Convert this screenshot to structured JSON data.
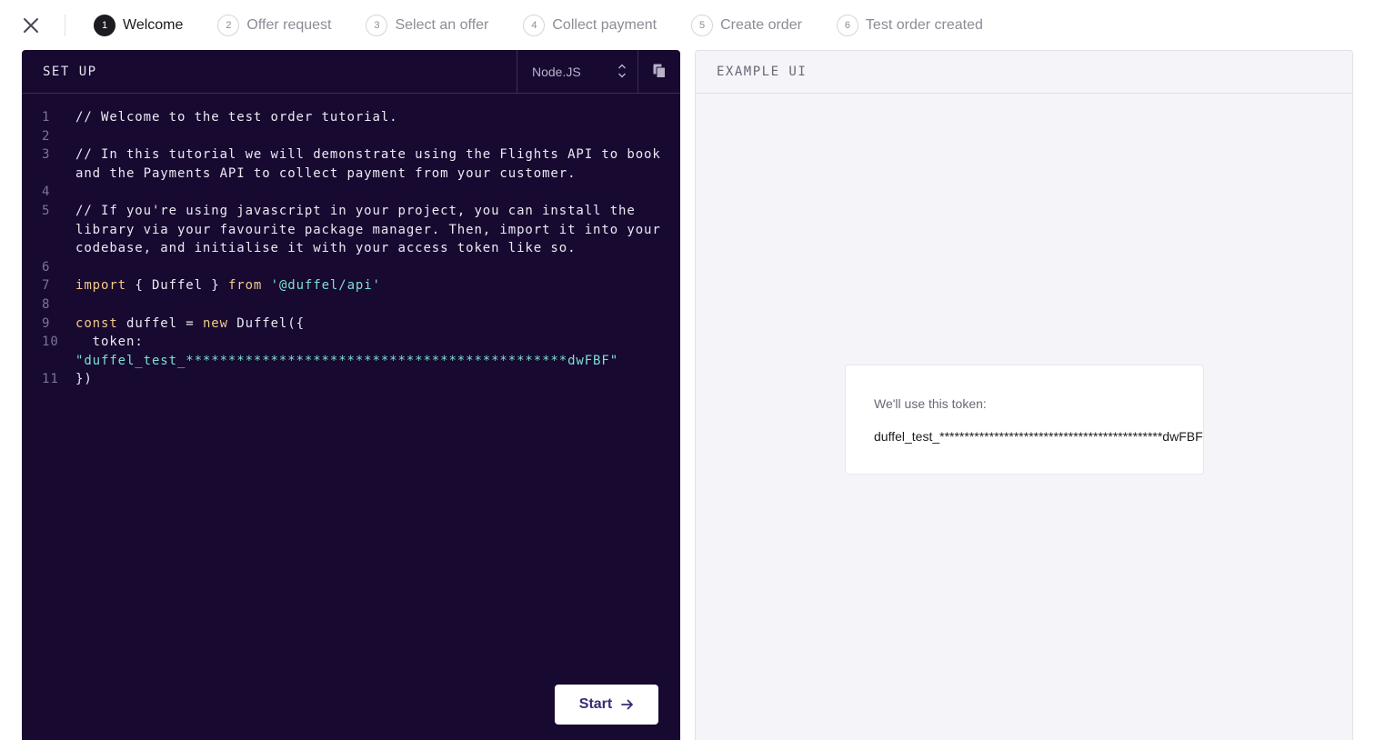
{
  "steps": [
    {
      "num": "1",
      "label": "Welcome"
    },
    {
      "num": "2",
      "label": "Offer request"
    },
    {
      "num": "3",
      "label": "Select an offer"
    },
    {
      "num": "4",
      "label": "Collect payment"
    },
    {
      "num": "5",
      "label": "Create order"
    },
    {
      "num": "6",
      "label": "Test order created"
    }
  ],
  "active_step": 1,
  "code_panel": {
    "title": "SET UP",
    "language": "Node.JS",
    "lines": [
      {
        "n": "1",
        "tokens": [
          {
            "t": "// Welcome to the test order tutorial.",
            "c": "plain"
          }
        ]
      },
      {
        "n": "2",
        "tokens": []
      },
      {
        "n": "3",
        "tokens": [
          {
            "t": "// In this tutorial we will demonstrate using the Flights API to book and the Payments API to collect payment from your customer.",
            "c": "plain"
          }
        ]
      },
      {
        "n": "4",
        "tokens": []
      },
      {
        "n": "5",
        "tokens": [
          {
            "t": "// If you're using javascript in your project, you can install the library via your favourite package manager. Then, import it into your codebase, and initialise it with your access token like so.",
            "c": "plain"
          }
        ]
      },
      {
        "n": "6",
        "tokens": []
      },
      {
        "n": "7",
        "tokens": [
          {
            "t": "import",
            "c": "kw"
          },
          {
            "t": " { Duffel } ",
            "c": "plain"
          },
          {
            "t": "from",
            "c": "kw"
          },
          {
            "t": " ",
            "c": "plain"
          },
          {
            "t": "'@duffel/api'",
            "c": "str"
          }
        ]
      },
      {
        "n": "8",
        "tokens": []
      },
      {
        "n": "9",
        "tokens": [
          {
            "t": "const",
            "c": "kw"
          },
          {
            "t": " duffel = ",
            "c": "plain"
          },
          {
            "t": "new",
            "c": "kw"
          },
          {
            "t": " Duffel({",
            "c": "plain"
          }
        ]
      },
      {
        "n": "10",
        "tokens": [
          {
            "t": "  token: ",
            "c": "plain"
          },
          {
            "t": "\"duffel_test_*********************************************dwFBF\"",
            "c": "str"
          }
        ]
      },
      {
        "n": "11",
        "tokens": [
          {
            "t": "})",
            "c": "plain"
          }
        ]
      }
    ],
    "start_label": "Start"
  },
  "example_panel": {
    "title": "EXAMPLE UI",
    "token_caption": "We'll use this token:",
    "token_value": "duffel_test_*********************************************dwFBF"
  },
  "colors": {
    "code_bg": "#170930",
    "keyword": "#f3c98b",
    "string": "#7ee0d0",
    "start_text": "#3b2a73"
  }
}
